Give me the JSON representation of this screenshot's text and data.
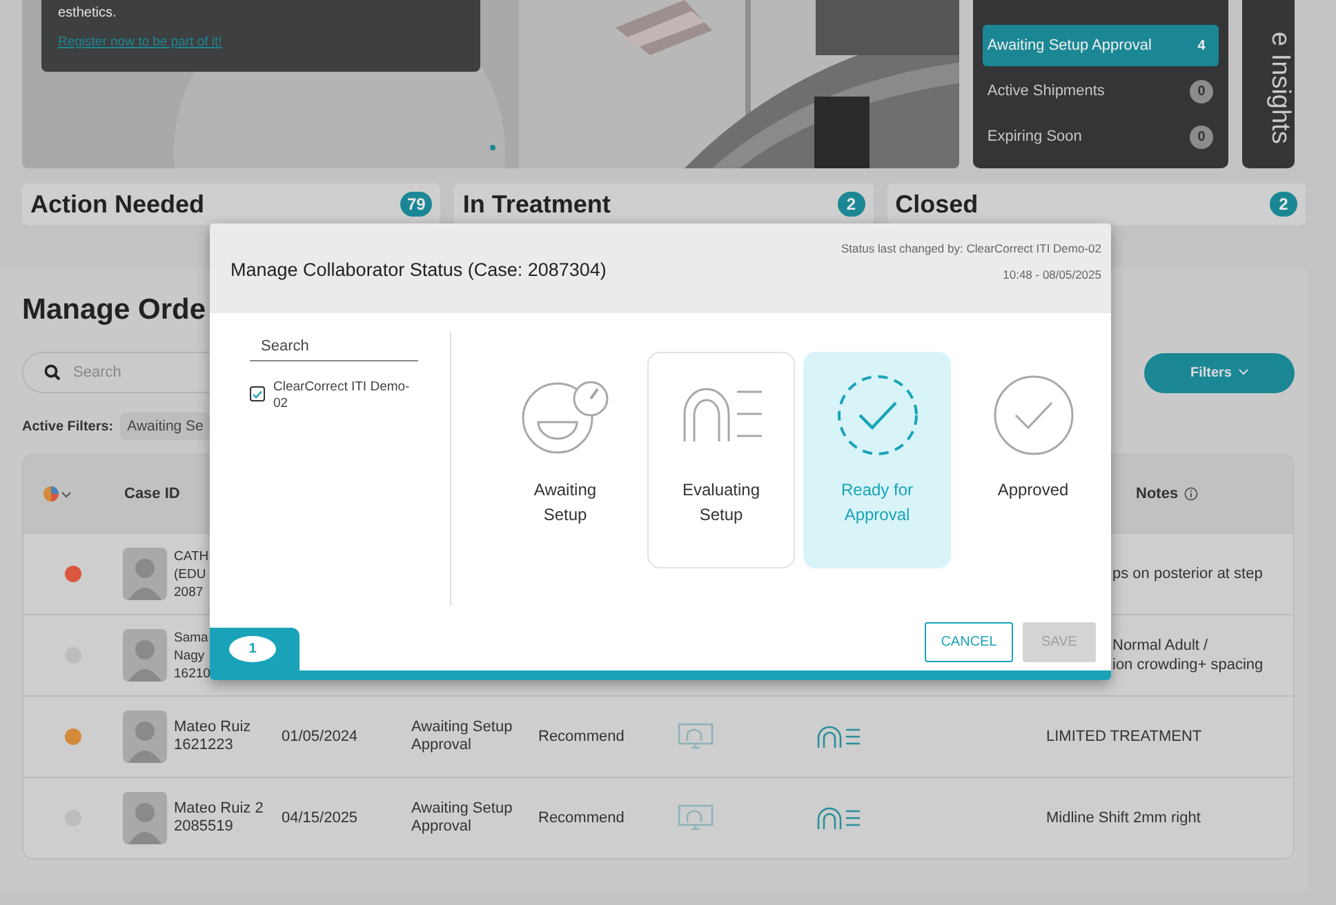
{
  "hero": {
    "card_text": "esthetics.",
    "card_link": "Register now to be part of it!"
  },
  "inbox": {
    "items": [
      {
        "label": "Awaiting Setup Approval",
        "count": "4",
        "selected": true
      },
      {
        "label": "Active Shipments",
        "count": "0",
        "selected": false
      },
      {
        "label": "Expiring Soon",
        "count": "0",
        "selected": false
      }
    ]
  },
  "insights_tab": "e Insights",
  "summary": [
    {
      "label": "Action Needed",
      "count": "79"
    },
    {
      "label": "In Treatment",
      "count": "2"
    },
    {
      "label": "Closed",
      "count": "2"
    }
  ],
  "orders": {
    "title": "Manage Orde",
    "search": {
      "placeholder": "Search"
    },
    "filters_button": "Filters",
    "active_filters_label": "Active Filters:",
    "active_filter_chip": "Awaiting Se",
    "columns": {
      "case_id": "Case ID",
      "notes": "Notes"
    },
    "rows": [
      {
        "kind": "partial",
        "color": "#d9573f",
        "name_lines": [
          "CATH",
          "(EDU",
          "2087"
        ],
        "notes_lines": [
          "ps on posterior at step"
        ]
      },
      {
        "kind": "partial",
        "color": "#bdbdbd",
        "name_lines": [
          "Sama",
          "Nagy",
          "16210"
        ],
        "notes_lines": [
          "Normal Adult /",
          "ion crowding+ spacing"
        ]
      },
      {
        "kind": "full",
        "color": "#d58a3a",
        "name_lines": [
          "Mateo Ruiz",
          "1621223"
        ],
        "date": "01/05/2024",
        "status": "Awaiting Setup Approval",
        "decision": "Recommend",
        "notes_lines": [
          "LIMITED TREATMENT"
        ]
      },
      {
        "kind": "full",
        "color": "#bdbdbd",
        "name_lines": [
          "Mateo Ruiz 2",
          "2085519"
        ],
        "date": "04/15/2025",
        "status": "Awaiting Setup Approval",
        "decision": "Recommend",
        "notes_lines": [
          "Midline Shift 2mm right"
        ]
      }
    ]
  },
  "modal": {
    "title": "Manage Collaborator Status (Case: 2087304)",
    "changed_by": "Status last changed by: ClearCorrect ITI Demo-02",
    "changed_at": "10:48  -  08/05/2025",
    "search": {
      "placeholder": "Search"
    },
    "collaborators": [
      {
        "label": "ClearCorrect ITI Demo-02",
        "checked": true
      }
    ],
    "steps": [
      {
        "kind": "awaiting",
        "label": "Awaiting Setup",
        "selected": false,
        "hovered": false
      },
      {
        "kind": "evaluating",
        "label": "Evaluating Setup",
        "selected": false,
        "hovered": true
      },
      {
        "kind": "ready",
        "label": "Ready for Approval",
        "selected": true,
        "hovered": false
      },
      {
        "kind": "approved",
        "label": "Approved",
        "selected": false,
        "hovered": false
      }
    ],
    "chat_count": "1",
    "cancel": "CANCEL",
    "save": {
      "label": "SAVE",
      "disabled": true
    }
  }
}
